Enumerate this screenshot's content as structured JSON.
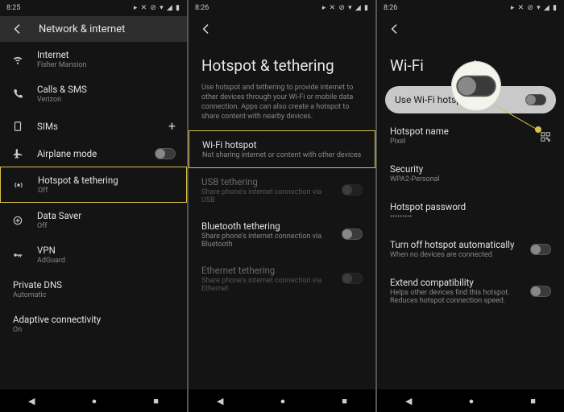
{
  "status": {
    "time1": "8:25",
    "time2": "8:26",
    "time3": "8:26",
    "right": "▸ ✕ ⊘ ▾ ◢ ▮"
  },
  "screen1": {
    "title": "Network & internet",
    "items": [
      {
        "label": "Internet",
        "sub": "Fisher Mansion"
      },
      {
        "label": "Calls & SMS",
        "sub": "Verizon"
      },
      {
        "label": "SIMs",
        "sub": ""
      },
      {
        "label": "Airplane mode",
        "sub": ""
      },
      {
        "label": "Hotspot & tethering",
        "sub": "Off"
      },
      {
        "label": "Data Saver",
        "sub": "Off"
      },
      {
        "label": "VPN",
        "sub": "AdGuard"
      },
      {
        "label": "Private DNS",
        "sub": "Automatic"
      },
      {
        "label": "Adaptive connectivity",
        "sub": "On"
      }
    ]
  },
  "screen2": {
    "title": "Hotspot & tethering",
    "desc": "Use hotspot and tethering to provide internet to other devices through your Wi-Fi or mobile data connection. Apps can also create a hotspot to share content with nearby devices.",
    "items": [
      {
        "label": "Wi-Fi hotspot",
        "sub": "Not sharing internet or content with other devices"
      },
      {
        "label": "USB tethering",
        "sub": "Share phone's internet connection via USB"
      },
      {
        "label": "Bluetooth tethering",
        "sub": "Share phone's internet connection via Bluetooth"
      },
      {
        "label": "Ethernet tethering",
        "sub": "Share phone's internet connection via Ethernet"
      }
    ]
  },
  "screen3": {
    "title_prefix": "Wi-Fi",
    "title_suffix": "t",
    "pill": "Use Wi-Fi hotspot",
    "items": [
      {
        "label": "Hotspot name",
        "sub": "Pixel"
      },
      {
        "label": "Security",
        "sub": "WPA2-Personal"
      },
      {
        "label": "Hotspot password",
        "sub": "•••••••••"
      },
      {
        "label": "Turn off hotspot automatically",
        "sub": "When no devices are connected"
      },
      {
        "label": "Extend compatibility",
        "sub": "Helps other devices find this hotspot. Reduces hotspot connection speed."
      }
    ]
  },
  "nav": {
    "back": "◀",
    "home": "●",
    "recent": "■"
  }
}
